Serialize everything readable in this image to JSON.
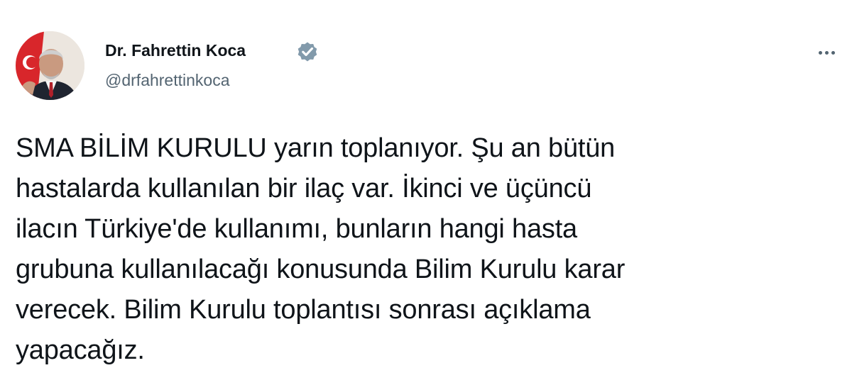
{
  "author": {
    "display_name": "Dr. Fahrettin Koca",
    "handle": "@drfahrettinkoca",
    "verified": true,
    "verified_badge_color": "#829aab",
    "avatar_icon": "profile-photo"
  },
  "more_icon": "more-options-icon",
  "tweet": {
    "lines": [
      "SMA BİLİM KURULU yarın toplanıyor. Şu an bütün",
      "hastalarda kullanılan bir ilaç var. İkinci ve üçüncü",
      "ilacın Türkiye'de kullanımı, bunların hangi hasta",
      "grubuna kullanılacağı konusunda Bilim Kurulu karar",
      "verecek. Bilim Kurulu toplantısı sonrası açıklama",
      "yapacağız."
    ]
  },
  "colors": {
    "text": "#0f1419",
    "secondary_text": "#536471",
    "background": "#ffffff"
  }
}
